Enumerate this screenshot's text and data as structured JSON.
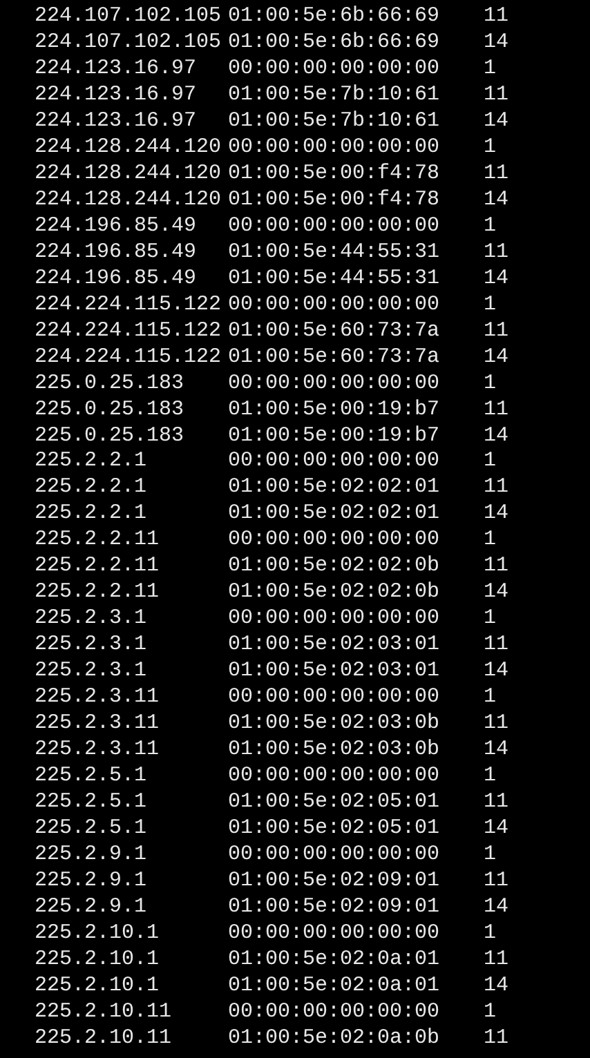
{
  "rows": [
    {
      "ip": "224.107.102.105",
      "mac": "01:00:5e:6b:66:69",
      "column_3": "11"
    },
    {
      "ip": "224.107.102.105",
      "mac": "01:00:5e:6b:66:69",
      "column_3": "14"
    },
    {
      "ip": "224.123.16.97",
      "mac": "00:00:00:00:00:00",
      "column_3": "1"
    },
    {
      "ip": "224.123.16.97",
      "mac": "01:00:5e:7b:10:61",
      "column_3": "11"
    },
    {
      "ip": "224.123.16.97",
      "mac": "01:00:5e:7b:10:61",
      "column_3": "14"
    },
    {
      "ip": "224.128.244.120",
      "mac": "00:00:00:00:00:00",
      "column_3": "1"
    },
    {
      "ip": "224.128.244.120",
      "mac": "01:00:5e:00:f4:78",
      "column_3": "11"
    },
    {
      "ip": "224.128.244.120",
      "mac": "01:00:5e:00:f4:78",
      "column_3": "14"
    },
    {
      "ip": "224.196.85.49",
      "mac": "00:00:00:00:00:00",
      "column_3": "1"
    },
    {
      "ip": "224.196.85.49",
      "mac": "01:00:5e:44:55:31",
      "column_3": "11"
    },
    {
      "ip": "224.196.85.49",
      "mac": "01:00:5e:44:55:31",
      "column_3": "14"
    },
    {
      "ip": "224.224.115.122",
      "mac": "00:00:00:00:00:00",
      "column_3": "1"
    },
    {
      "ip": "224.224.115.122",
      "mac": "01:00:5e:60:73:7a",
      "column_3": "11"
    },
    {
      "ip": "224.224.115.122",
      "mac": "01:00:5e:60:73:7a",
      "column_3": "14"
    },
    {
      "ip": "225.0.25.183",
      "mac": "00:00:00:00:00:00",
      "column_3": "1"
    },
    {
      "ip": "225.0.25.183",
      "mac": "01:00:5e:00:19:b7",
      "column_3": "11"
    },
    {
      "ip": "225.0.25.183",
      "mac": "01:00:5e:00:19:b7",
      "column_3": "14"
    },
    {
      "ip": "225.2.2.1",
      "mac": "00:00:00:00:00:00",
      "column_3": "1"
    },
    {
      "ip": "225.2.2.1",
      "mac": "01:00:5e:02:02:01",
      "column_3": "11"
    },
    {
      "ip": "225.2.2.1",
      "mac": "01:00:5e:02:02:01",
      "column_3": "14"
    },
    {
      "ip": "225.2.2.11",
      "mac": "00:00:00:00:00:00",
      "column_3": "1"
    },
    {
      "ip": "225.2.2.11",
      "mac": "01:00:5e:02:02:0b",
      "column_3": "11"
    },
    {
      "ip": "225.2.2.11",
      "mac": "01:00:5e:02:02:0b",
      "column_3": "14"
    },
    {
      "ip": "225.2.3.1",
      "mac": "00:00:00:00:00:00",
      "column_3": "1"
    },
    {
      "ip": "225.2.3.1",
      "mac": "01:00:5e:02:03:01",
      "column_3": "11"
    },
    {
      "ip": "225.2.3.1",
      "mac": "01:00:5e:02:03:01",
      "column_3": "14"
    },
    {
      "ip": "225.2.3.11",
      "mac": "00:00:00:00:00:00",
      "column_3": "1"
    },
    {
      "ip": "225.2.3.11",
      "mac": "01:00:5e:02:03:0b",
      "column_3": "11"
    },
    {
      "ip": "225.2.3.11",
      "mac": "01:00:5e:02:03:0b",
      "column_3": "14"
    },
    {
      "ip": "225.2.5.1",
      "mac": "00:00:00:00:00:00",
      "column_3": "1"
    },
    {
      "ip": "225.2.5.1",
      "mac": "01:00:5e:02:05:01",
      "column_3": "11"
    },
    {
      "ip": "225.2.5.1",
      "mac": "01:00:5e:02:05:01",
      "column_3": "14"
    },
    {
      "ip": "225.2.9.1",
      "mac": "00:00:00:00:00:00",
      "column_3": "1"
    },
    {
      "ip": "225.2.9.1",
      "mac": "01:00:5e:02:09:01",
      "column_3": "11"
    },
    {
      "ip": "225.2.9.1",
      "mac": "01:00:5e:02:09:01",
      "column_3": "14"
    },
    {
      "ip": "225.2.10.1",
      "mac": "00:00:00:00:00:00",
      "column_3": "1"
    },
    {
      "ip": "225.2.10.1",
      "mac": "01:00:5e:02:0a:01",
      "column_3": "11"
    },
    {
      "ip": "225.2.10.1",
      "mac": "01:00:5e:02:0a:01",
      "column_3": "14"
    },
    {
      "ip": "225.2.10.11",
      "mac": "00:00:00:00:00:00",
      "column_3": "1"
    },
    {
      "ip": "225.2.10.11",
      "mac": "01:00:5e:02:0a:0b",
      "column_3": "11"
    }
  ]
}
